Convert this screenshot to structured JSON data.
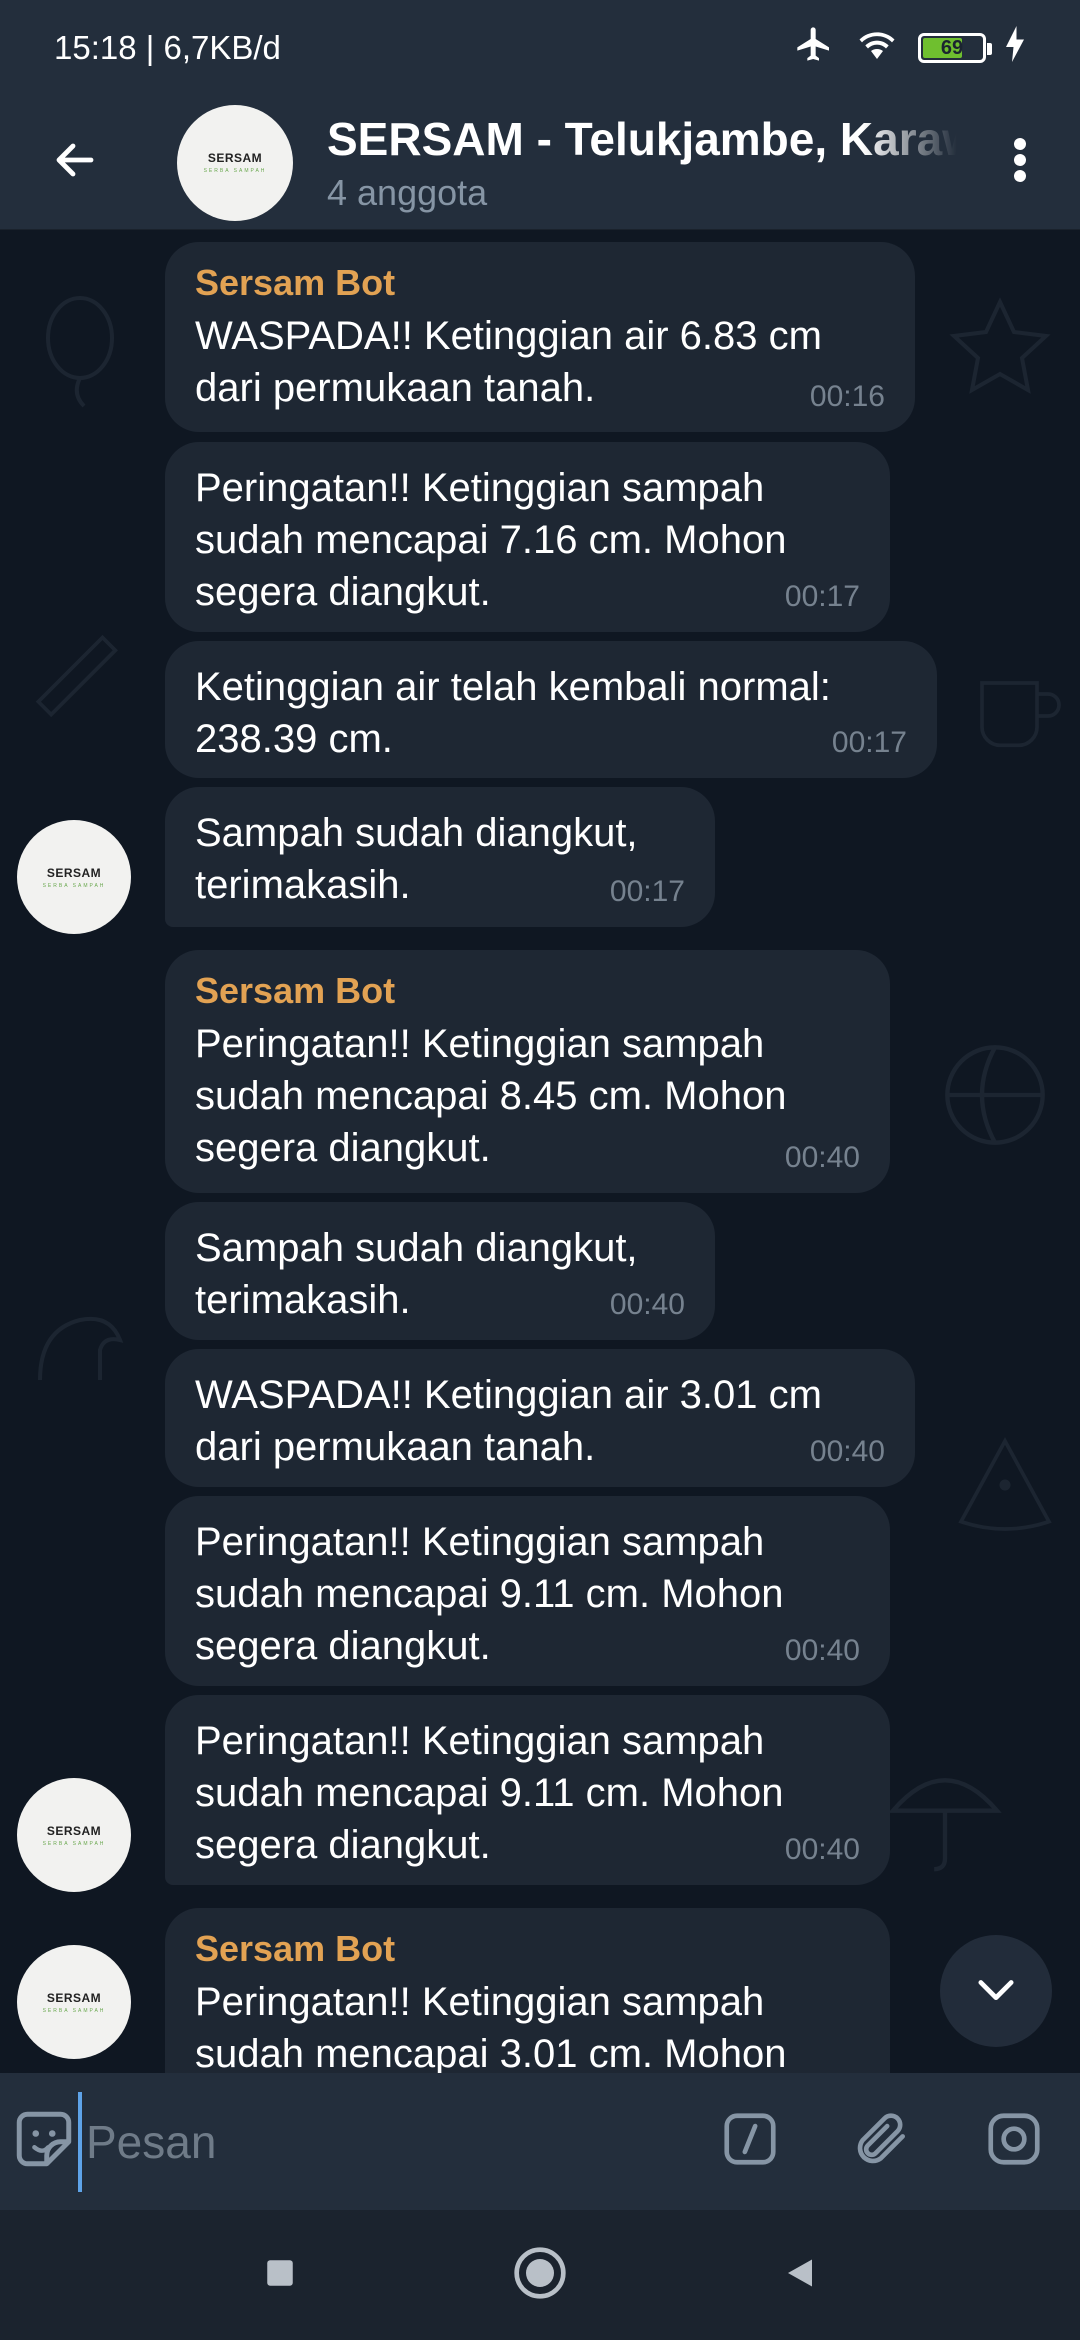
{
  "status_bar": {
    "time_speed": "15:18 | 6,7KB/d",
    "battery_level": "69",
    "battery_fraction": 0.69,
    "icons": [
      "airplane-icon",
      "wifi-icon",
      "battery-icon",
      "charging-icon"
    ]
  },
  "header": {
    "title": "SERSAM - Telukjambe, Karawang",
    "subtitle": "4 anggota",
    "avatar_brand": "SERSAM",
    "avatar_tagline": "SERBA SAMPAH"
  },
  "messages": [
    {
      "sender": "Sersam Bot",
      "text": "WASPADA!! Ketinggian air 6.83 cm\ndari permukaan tanah.",
      "time": "00:16"
    },
    {
      "sender": "",
      "text": "Peringatan!! Ketinggian sampah\nsudah mencapai 7.16 cm. Mohon\nsegera diangkut.",
      "time": "00:17"
    },
    {
      "sender": "",
      "text": "Ketinggian air telah kembali normal:\n238.39 cm.",
      "time": "00:17"
    },
    {
      "sender": "",
      "text": "Sampah sudah diangkut,\nterimakasih.",
      "time": "00:17"
    },
    {
      "sender": "Sersam Bot",
      "text": "Peringatan!! Ketinggian sampah\nsudah mencapai 8.45 cm. Mohon\nsegera diangkut.",
      "time": "00:40"
    },
    {
      "sender": "",
      "text": "Sampah sudah diangkut,\nterimakasih.",
      "time": "00:40"
    },
    {
      "sender": "",
      "text": "WASPADA!! Ketinggian air 3.01 cm\ndari permukaan tanah.",
      "time": "00:40"
    },
    {
      "sender": "",
      "text": "Peringatan!! Ketinggian sampah\nsudah mencapai 9.11 cm. Mohon\nsegera diangkut.",
      "time": "00:40"
    },
    {
      "sender": "",
      "text": "Peringatan!! Ketinggian sampah\nsudah mencapai 9.11 cm. Mohon\nsegera diangkut.",
      "time": "00:40"
    },
    {
      "sender": "Sersam Bot",
      "text": "Peringatan!! Ketinggian sampah\nsudah mencapai 3.01 cm. Mohon",
      "time": ""
    }
  ],
  "input": {
    "placeholder": "Pesan",
    "value": ""
  },
  "colors": {
    "accent": "#5ea3e8",
    "sender_name": "#e2a253",
    "bubble": "#1e2733",
    "chat_background": "#0f1722",
    "header": "#232e3c"
  }
}
